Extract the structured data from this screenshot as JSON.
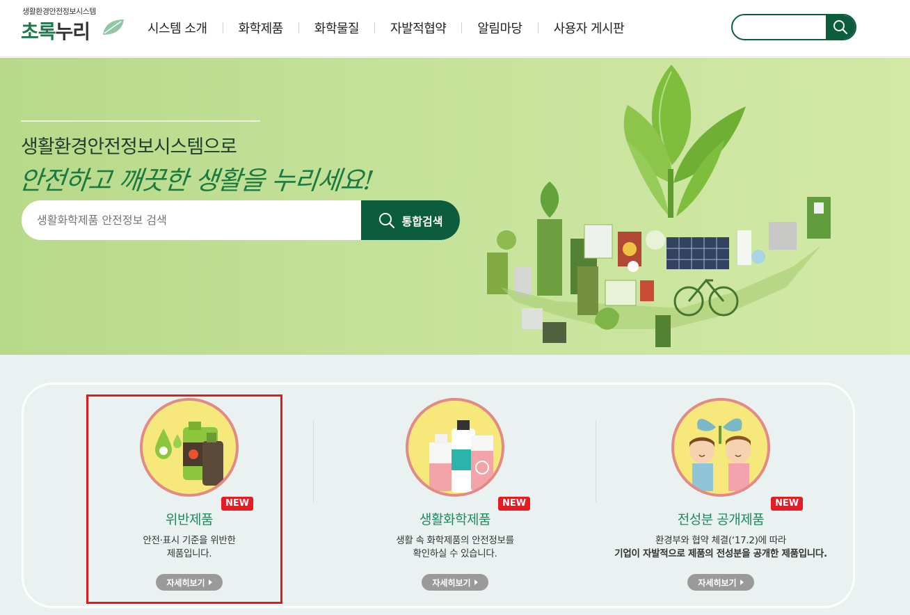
{
  "header": {
    "logo_small": "생활환경안전정보시스템",
    "logo_main_green": "초록",
    "logo_main_dark": "누리",
    "nav": [
      "시스템 소개",
      "화학제품",
      "화학물질",
      "자발적협약",
      "알림마당",
      "사용자 게시판"
    ],
    "search_placeholder": ""
  },
  "hero": {
    "title1": "생활환경안전정보시스템으로",
    "title2": "안전하고 깨끗한 생활을 누리세요!",
    "search_placeholder": "생활화학제품 안전정보 검색",
    "search_button": "통합검색"
  },
  "cards": [
    {
      "badge": "NEW",
      "title": "위반제품",
      "desc1": "안전·표시 기준을 위반한",
      "desc2": "제품입니다.",
      "more": "자세히보기"
    },
    {
      "badge": "NEW",
      "title": "생활화학제품",
      "desc1": "생활 속 화학제품의 안전정보를",
      "desc2": "확인하실 수 있습니다.",
      "more": "자세히보기"
    },
    {
      "badge": "NEW",
      "title": "전성분 공개제품",
      "desc1": "환경부와 협약 체결(‘17.2)에 따라",
      "desc2": "기업이 자발적으로 제품의 전성분을 공개한 제품입니다.",
      "more": "자세히보기"
    }
  ],
  "colors": {
    "brand": "#0c5d3e",
    "accent": "#1d8a5c",
    "badge": "#e81b22",
    "highlight": "#e01b1b"
  },
  "icons": [
    "leaf-icon",
    "search-icon",
    "caret-right-icon"
  ]
}
